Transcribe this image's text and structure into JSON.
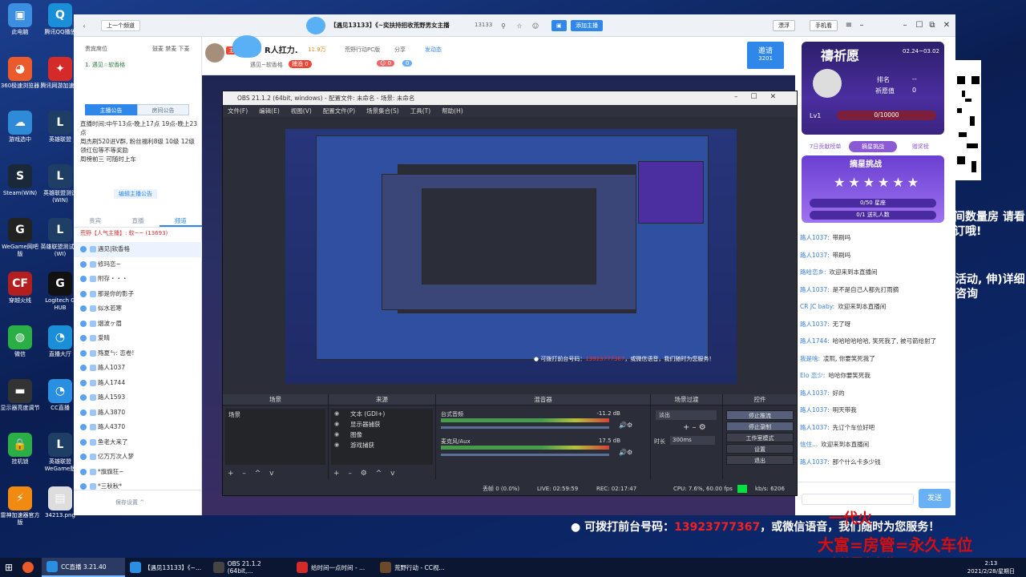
{
  "desktop": {
    "icons": [
      {
        "label": "此电脑",
        "color": "#3b8ee0",
        "glyph": "▣"
      },
      {
        "label": "腾讯QQ播放",
        "color": "#1a8fd8",
        "glyph": "Q"
      },
      {
        "label": "360极速浏览器",
        "color": "#ea5a2a",
        "glyph": "◕"
      },
      {
        "label": "腾讯网游加速器",
        "color": "#d52a2a",
        "glyph": "✦"
      },
      {
        "label": "游戏选中",
        "color": "#2f8bd8",
        "glyph": "☁"
      },
      {
        "label": "英雄联盟",
        "color": "#1f3e66",
        "glyph": "L"
      },
      {
        "label": "Steam(WIN)",
        "color": "#1b2838",
        "glyph": "S"
      },
      {
        "label": "英雄联盟测试(WIN)",
        "color": "#1f3e66",
        "glyph": "L"
      },
      {
        "label": "WeGame网吧版",
        "color": "#222",
        "glyph": "G"
      },
      {
        "label": "英雄联盟测试版(WI)",
        "color": "#1f3e66",
        "glyph": "L"
      },
      {
        "label": "穿越火线",
        "color": "#b31f1f",
        "glyph": "CF"
      },
      {
        "label": "Logitech G HUB",
        "color": "#111",
        "glyph": "G"
      },
      {
        "label": "微信",
        "color": "#2aae45",
        "glyph": "◍"
      },
      {
        "label": "直播大厅",
        "color": "#1a8fd8",
        "glyph": "◔"
      },
      {
        "label": "显示器亮度调节",
        "color": "#333",
        "glyph": "▬"
      },
      {
        "label": "CC直播",
        "color": "#2a8fe0",
        "glyph": "◔"
      },
      {
        "label": "挂机锁",
        "color": "#2aae45",
        "glyph": "🔒"
      },
      {
        "label": "英雄联盟WeGame版",
        "color": "#1f3e66",
        "glyph": "L"
      },
      {
        "label": "雷神加速器官方版",
        "color": "#f08a10",
        "glyph": "⚡"
      },
      {
        "label": "34213.png",
        "color": "#ddd",
        "glyph": "▤"
      }
    ]
  },
  "cc": {
    "titlebar": {
      "back_label": "上一个频道",
      "room_title": "【遇见13133】《~奕扶持招收荒野男女主播",
      "room_id": "13133",
      "add_anchor": "添加主播",
      "float_label": "漂浮",
      "mobile_label": "手机看"
    },
    "left": {
      "top_tabs": [
        "贵宾席位",
        "鼓麦  禁麦  下麦"
      ],
      "host_line": "1. 遇见☆软香格",
      "tabs": [
        "主播公告",
        "房间公告"
      ],
      "notice": "直播时间:中午13点-晚上17点  19点-晚上23点\n周杰刷520进V群, 粉丝福利8级 10级 12级领红包等不等奖励\n周榜前三 可随时上车",
      "edit_notice": "编辑主播公告",
      "sub_tabs": [
        "贵宾",
        "直播",
        "频道"
      ],
      "channel_line": "荒野【人气主播】: 软~~ (13693)",
      "viewers": [
        "遇见|软香格",
        "修玛恋~",
        "附存・・・",
        "那是你的影子",
        "似水若寒",
        "烟波ヶ眉",
        "爱晴",
        "殇夏ㄣ: 恋卷!",
        "路人1037",
        "路人1744",
        "路人1593",
        "路人3870",
        "路人4370",
        "鱼老大来了",
        "亿万万次人梦",
        "*旗旗狂~",
        "*三秋秋*"
      ],
      "bottom_link": "保存设置 ^"
    },
    "header": {
      "anchor_badge": "主播助手",
      "anchor_name": "R人扛力.",
      "fans": "11.9万",
      "game": "荒野行动PC版",
      "share": "分享",
      "follow_tag": "发动态",
      "level_label": "捕渔",
      "level_value": "0",
      "invite_label": "邀请",
      "invite_count": "3201"
    },
    "right": {
      "date_range": "02.24~03.02",
      "rank_label": "排名",
      "rank_value": "--",
      "prayer_label": "祈愿值",
      "prayer_value": "0",
      "level": "Lv1",
      "progress": "0/10000",
      "tabs": [
        "7日贡献榜单",
        "摘星挑战",
        "赠奖榜"
      ],
      "challenge_title": "摘星挑战",
      "star_count": "0/50 星座",
      "gift_count": "0/1 送礼人数",
      "chats": [
        {
          "name": "路人1037:",
          "text": "带刷吗"
        },
        {
          "name": "路人1037:",
          "text": "带刷吗"
        },
        {
          "name": "路哈恋乡:",
          "text": "欢迎来到本直播间"
        },
        {
          "name": "路人1037:",
          "text": "是不是自己人都先打雨摘"
        },
        {
          "name": "CR JC baby:",
          "text": "欢迎来到本直播间"
        },
        {
          "name": "路人1037:",
          "text": "无了呀"
        },
        {
          "name": "路人1744:",
          "text": "哈哈哈哈哈哈, 笑死我了, 被弓箭给射了"
        },
        {
          "name": "我是啥:",
          "text": "凌熙, 你要笑死我了"
        },
        {
          "name": "Elo 恋少:",
          "text": "哈哈你要笑死我"
        },
        {
          "name": "路人1037:",
          "text": "好的"
        },
        {
          "name": "路人1037:",
          "text": "明天带我"
        },
        {
          "name": "路人1037:",
          "text": "先订个车位好吧"
        },
        {
          "name": "信住...",
          "text": "欢迎来到本直播间"
        },
        {
          "name": "路人1037:",
          "text": "那个什么卡多少钱"
        }
      ],
      "send": "发送"
    }
  },
  "obs": {
    "title": "OBS 21.1.2 (64bit, windows) - 配置文件: 未命名 - 场景: 未命名",
    "menu": [
      "文件(F)",
      "编辑(E)",
      "视图(V)",
      "配置文件(P)",
      "场景集合(S)",
      "工具(T)",
      "帮助(H)"
    ],
    "docks": {
      "scenes": {
        "title": "场景",
        "items": [
          "场景"
        ]
      },
      "sources": {
        "title": "来源",
        "items": [
          "文本 (GDI+)",
          "显示器捕获",
          "图像",
          "游戏捕获"
        ]
      },
      "mixer": {
        "title": "混音器",
        "ch1": "台式音频",
        "ch1_db": "-11.2 dB",
        "ch2": "麦克风/Aux",
        "ch2_db": "17.5 dB"
      },
      "transitions": {
        "title": "场景过渡",
        "mode": "淡出",
        "duration_label": "时长",
        "duration": "300ms"
      },
      "controls": {
        "title": "控件",
        "buttons": [
          "停止推流",
          "停止录制",
          "工作室模式",
          "设置",
          "退出"
        ]
      }
    },
    "status": {
      "dropped": "丢帧 0 (0.0%)",
      "live": "LIVE: 02:59:59",
      "rec": "REC: 02:17:47",
      "cpu": "CPU: 7.6%, 60.00 fps",
      "bitrate": "kb/s: 6206"
    }
  },
  "overlay": {
    "ad_prefix": "● 可拨打前台号码：",
    "ad_phone": "13923777367",
    "ad_suffix": "，或微信语音，我们随时为您服务！",
    "red_line1": "一代火",
    "red_line2": "大富=房管=永久车位",
    "red_line3": "守护团定车位",
    "side_text": "间数量房  请看订哦!",
    "side_text2": "活动,  伸)详细咨询"
  },
  "taskbar": {
    "items": [
      {
        "label": "CC直播 3.21.40",
        "color": "#2a8fe0"
      },
      {
        "label": "【遇见13133】《~...",
        "color": "#2a8fe0"
      },
      {
        "label": "OBS 21.1.2 (64bit,...",
        "color": "#444"
      },
      {
        "label": "给时间一点时间 - ...",
        "color": "#d52a2a"
      },
      {
        "label": "荒野行动 - CC视...",
        "color": "#6a4a2a"
      }
    ],
    "time": "2:13",
    "date": "2021/2/28/星期日"
  }
}
